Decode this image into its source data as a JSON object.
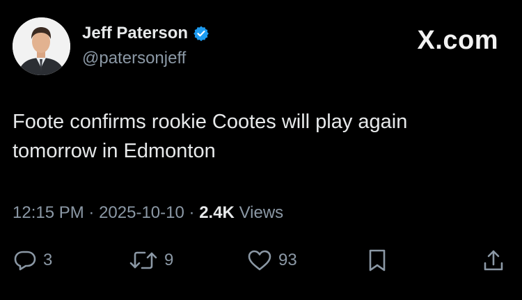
{
  "author": {
    "display_name": "Jeff Paterson",
    "handle": "@patersonjeff",
    "verified": true,
    "verified_color": "#1d9bf0"
  },
  "brand": "X.com",
  "tweet": {
    "text": "Foote confirms rookie Cootes will play again tomorrow in Edmonton"
  },
  "meta": {
    "time": "12:15 PM",
    "separator": "·",
    "date": "2025-10-10",
    "views_count": "2.4K",
    "views_label": "Views"
  },
  "actions": {
    "replies": "3",
    "reposts": "9",
    "likes": "93"
  },
  "icons": [
    "reply-icon",
    "repost-icon",
    "like-icon",
    "bookmark-icon",
    "share-icon",
    "verified-badge-icon"
  ]
}
